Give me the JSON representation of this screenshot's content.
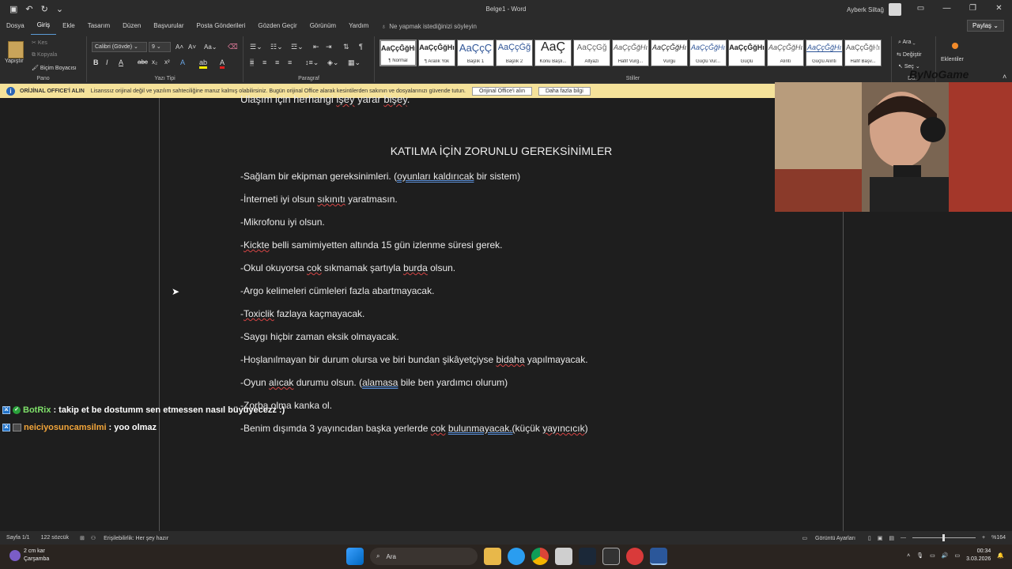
{
  "titlebar": {
    "doc_title": "Belge1 - Word",
    "user_name": "Ayberk Siltağ"
  },
  "tabs": [
    "Dosya",
    "Giriş",
    "Ekle",
    "Tasarım",
    "Düzen",
    "Başvurular",
    "Posta Gönderileri",
    "Gözden Geçir",
    "Görünüm",
    "Yardım"
  ],
  "tellme": "Ne yapmak istediğinizi söyleyin",
  "share": "Paylaş",
  "ribbon": {
    "paste": "Yapıştır",
    "cut": "Kes",
    "copy": "Kopyala",
    "format_painter": "Biçim Boyacısı",
    "group_pano": "Pano",
    "font_name": "Calibri (Gövde)",
    "font_size": "9",
    "group_font": "Yazı Tipi",
    "group_paragraph": "Paragraf",
    "group_styles": "Stiller",
    "styles": [
      {
        "preview": "AaÇçĞğHı",
        "label": "¶ Normal"
      },
      {
        "preview": "AaÇçĞğHı",
        "label": "¶ Aralık Yok"
      },
      {
        "preview": "AaÇçÇ",
        "label": "Başlık 1"
      },
      {
        "preview": "AaÇçĞğ",
        "label": "Başlık 2"
      },
      {
        "preview": "AaÇ",
        "label": "Konu Başlı..."
      },
      {
        "preview": "AaÇçĞğ",
        "label": "Altyazı"
      },
      {
        "preview": "AaÇçĞğHı",
        "label": "Hafif Vurg..."
      },
      {
        "preview": "AaÇçĞğHı",
        "label": "Vurgu"
      },
      {
        "preview": "AaÇçĞğHı",
        "label": "Güçlü Vur..."
      },
      {
        "preview": "AaÇçĞğHı",
        "label": "Güçlü"
      },
      {
        "preview": "AaÇçĞğHı",
        "label": "Alıntı"
      },
      {
        "preview": "AaÇçĞğHı",
        "label": "Güçlü Alıntı"
      },
      {
        "preview": "AaÇçĞğHı",
        "label": "Hafif Başv..."
      }
    ],
    "find": "Ara",
    "replace": "Değiştir",
    "select": "Seç",
    "group_edit": "Dü...",
    "addins": "Eklentiler"
  },
  "warning": {
    "head": "ORİJİNAL OFFICE'İ ALIN",
    "text": "Lisanssız orijinal değil ve yazılım sahteciliğine maruz kalmış olabilirsiniz. Bugün orijinal Office alarak kesintilerden sakının ve dosyalarınızı güvende tutun.",
    "btn1": "Orijinal Office'i alın",
    "btn2": "Daha fazla bilgi"
  },
  "document": {
    "top_line": "Ulaşım için herhangi işey yarar bişey.",
    "heading": "KATILMA İÇİN ZORUNLU GEREKSİNİMLER",
    "lines": [
      "-Sağlam bir ekipman gereksinimleri. (oyunları kaldırıcak bir sistem)",
      "-İnterneti iyi olsun sıkınıtı yaratmasın.",
      "-Mikrofonu iyi olsun.",
      "-Kickte belli samimiyetten altında 15 gün izlenme süresi gerek.",
      "-Okul okuyorsa cok sıkmamak şartıyla burda olsun.",
      "-Argo kelimeleri cümleleri fazla abartmayacak.",
      "-Toxiclik fazlaya kaçmayacak.",
      "-Saygı hiçbir zaman eksik olmayacak.",
      "-Hoşlanılmayan bir durum olursa ve biri bundan şikâyetçiyse bidaha yapılmayacak.",
      "-Oyun alıcak durumu olsun. (alamasa bile ben yardımcı olurum)",
      "-Zorba olma kanka ol.",
      "-Benim dışımda 3 yayıncıdan başka yerlerde cok bulunmayacak.(küçük yayıncıcık)"
    ]
  },
  "watermark": "ByNoGame",
  "chat": [
    {
      "user": "BotRix",
      "message": " : takip et be dostumm sen etmessen nasıl büyüyecezz :)"
    },
    {
      "user": "neiciyosuncamsilmi",
      "message": " : yoo olmaz"
    }
  ],
  "status": {
    "page": "Sayfa 1/1",
    "words": "122 sözcük",
    "accessibility": "Erişilebilirlik: Her şey hazır",
    "display": "Görüntü Ayarları",
    "zoom": "%164"
  },
  "taskbar": {
    "weather_temp": "2 cm kar",
    "weather_day": "Çarşamba",
    "search": "Ara",
    "time": "00:34",
    "date": "3.03.2026"
  },
  "colors": {
    "accent": "#5b9bd5",
    "warning_bg": "#f5e29a",
    "botrix": "#7fe06a",
    "user2": "#f2a53a"
  }
}
